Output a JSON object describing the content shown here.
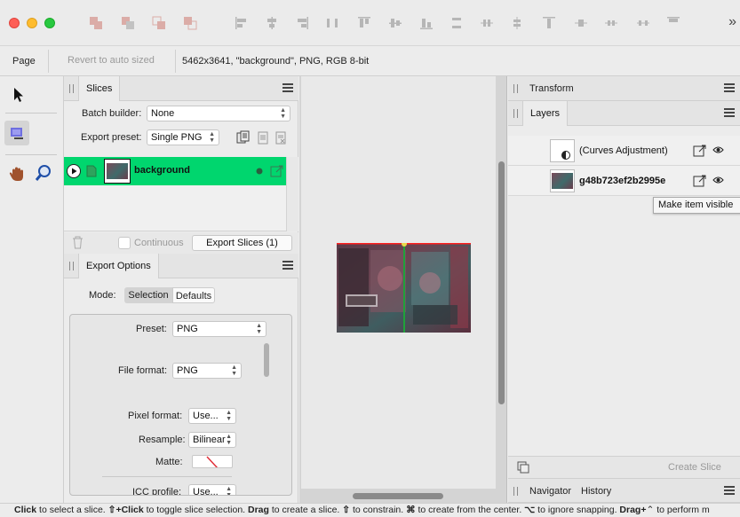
{
  "context_toolbar": {
    "page_label": "Page",
    "revert_label": "Revert to auto sized",
    "document_info": "5462x3641, \"background\", PNG, RGB 8-bit"
  },
  "slices_panel": {
    "title": "Slices",
    "batch_builder_label": "Batch builder:",
    "batch_builder_value": "None",
    "export_preset_label": "Export preset:",
    "export_preset_value": "Single PNG",
    "slice_items": [
      {
        "name": "background"
      }
    ],
    "continuous_label": "Continuous",
    "export_button_label": "Export Slices (1)",
    "row_color": "#00d66e"
  },
  "export_options": {
    "title": "Export Options",
    "mode_label": "Mode:",
    "mode_selection": "Selection",
    "mode_defaults": "Defaults",
    "preset_label": "Preset:",
    "preset_value": "PNG",
    "file_format_label": "File format:",
    "file_format_value": "PNG",
    "pixel_format_label": "Pixel format:",
    "pixel_format_value": "Use...",
    "resample_label": "Resample:",
    "resample_value": "Bilinear",
    "matte_label": "Matte:",
    "icc_profile_label": "ICC profile:",
    "icc_profile_value": "Use..."
  },
  "right_panels": {
    "transform_title": "Transform",
    "layers_title": "Layers",
    "layers": [
      {
        "name": "(Curves Adjustment)",
        "bold": false
      },
      {
        "name": "g48b723ef2b2995e",
        "bold": true
      }
    ],
    "create_slice_label": "Create Slice",
    "navigator_tab": "Navigator",
    "history_tab": "History",
    "tooltip": "Make item visible"
  },
  "status_bar": {
    "segments": [
      {
        "text": "Click",
        "bold": true
      },
      {
        "text": " to select a slice. ",
        "bold": false
      },
      {
        "text": "⇧+Click",
        "bold": true
      },
      {
        "text": " to toggle slice selection. ",
        "bold": false
      },
      {
        "text": "Drag",
        "bold": true
      },
      {
        "text": " to create a slice. ",
        "bold": false
      },
      {
        "text": "⇧",
        "bold": true
      },
      {
        "text": " to constrain. ",
        "bold": false
      },
      {
        "text": "⌘",
        "bold": true
      },
      {
        "text": " to create from the center. ",
        "bold": false
      },
      {
        "text": "⌥",
        "bold": true
      },
      {
        "text": " to ignore snapping. ",
        "bold": false
      },
      {
        "text": "Drag+",
        "bold": true
      },
      {
        "text": "⌃ to perform m",
        "bold": false
      }
    ]
  }
}
